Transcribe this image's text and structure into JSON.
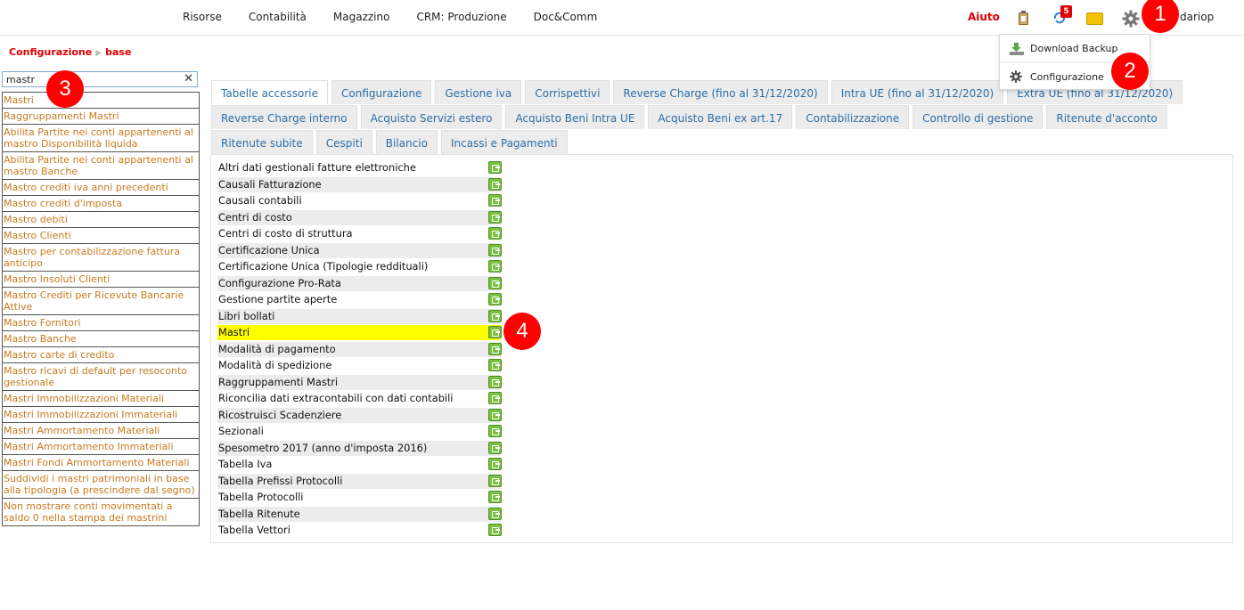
{
  "topnav": {
    "links": [
      "Risorse",
      "Contabilità",
      "Magazzino",
      "CRM: Produzione",
      "Doc&Comm"
    ],
    "help": "Aiuto",
    "notification_count": "5",
    "username": "dariop"
  },
  "icons": {
    "clipboard": "clipboard-icon",
    "sync": "sync-icon",
    "mail": "mail-icon",
    "settings": "gear-icon"
  },
  "user_menu": {
    "items": [
      "Download Backup",
      "Configurazione"
    ]
  },
  "breadcrumb": {
    "items": [
      "Configurazione",
      "base"
    ]
  },
  "search": {
    "value": "mastr",
    "clear": "✕",
    "results": [
      "Mastri",
      "Raggruppamenti Mastri",
      "Abilita Partite nei conti appartenenti al mastro Disponibilità liquida",
      "Abilita Partite nei conti appartenenti al mastro Banche",
      "Mastro crediti iva anni precedenti",
      "Mastro crediti d'imposta",
      "Mastro debiti",
      "Mastro Clienti",
      "Mastro per contabilizzazione fattura anticipo",
      "Mastro Insoluti Clienti",
      "Mastro Crediti per Ricevute Bancarie Attive",
      "Mastro Fornitori",
      "Mastro Banche",
      "Mastro carte di credito",
      "Mastro ricavi di default per resoconto gestionale",
      "Mastri Immobilizzazioni Materiali",
      "Mastri Immobilizzazioni Immateriali",
      "Mastri Ammortamento Materiali",
      "Mastri Ammortamento Immateriali",
      "Mastri Fondi Ammortamento Materiali",
      "Suddividi i mastri patrimoniali in base alla tipologia (a prescindere dal segno)",
      "Non mostrare conti movimentati a saldo 0 nella stampa dei mastrini"
    ]
  },
  "tabs": {
    "rows": [
      [
        "Tabelle accessorie",
        "Configurazione",
        "Gestione iva",
        "Corrispettivi",
        "Reverse Charge (fino al 31/12/2020)",
        "Intra UE (fino al 31/12/2020)",
        "Extra UE (fino al 31/12/2020)"
      ],
      [
        "Reverse Charge interno",
        "Acquisto Servizi estero",
        "Acquisto Beni Intra UE",
        "Acquisto Beni ex art.17",
        "Contabilizzazione",
        "Controllo di gestione",
        "Ritenute d'acconto"
      ],
      [
        "Ritenute subite",
        "Cespiti",
        "Bilancio",
        "Incassi e Pagamenti"
      ]
    ],
    "active": "Tabelle accessorie"
  },
  "tables": {
    "items": [
      "Altri dati gestionali fatture elettroniche",
      "Causali Fatturazione",
      "Causali contabili",
      "Centri di costo",
      "Centri di costo di struttura",
      "Certificazione Unica",
      "Certificazione Unica (Tipologie reddituali)",
      "Configurazione Pro-Rata",
      "Gestione partite aperte",
      "Libri bollati",
      "Mastri",
      "Modalità di pagamento",
      "Modalità di spedizione",
      "Raggruppamenti Mastri",
      "Riconcilia dati extracontabili con dati contabili",
      "Ricostruisci Scadenziere",
      "Sezionali",
      "Spesometro 2017 (anno d'imposta 2016)",
      "Tabella Iva",
      "Tabella Prefissi Protocolli",
      "Tabella Protocolli",
      "Tabella Ritenute",
      "Tabella Vettori"
    ],
    "highlighted": "Mastri"
  },
  "markers": [
    "1",
    "2",
    "3",
    "4"
  ],
  "colors": {
    "accent_red": "#e00000",
    "tab_text": "#2b6ea8",
    "result_text": "#c87a1e",
    "highlight": "#ffff00",
    "marker": "#ff0000"
  }
}
